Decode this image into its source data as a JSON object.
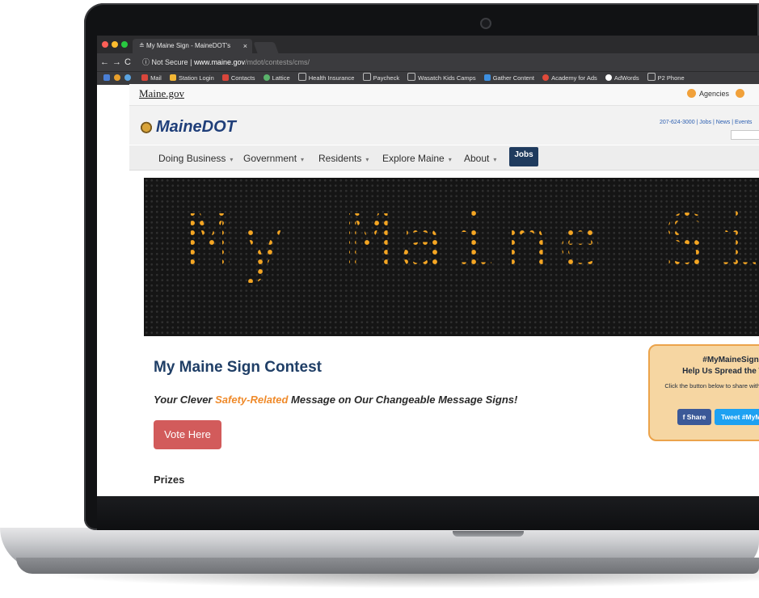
{
  "browser": {
    "tab_title": "My Maine Sign - MaineDOT's",
    "url_security": "Not Secure",
    "url_host": "www.maine.gov",
    "url_path": "/mdot/contests/cms/",
    "bookmarks": [
      "Mail",
      "Station Login",
      "Contacts",
      "Lattice",
      "Health Insurance",
      "Paycheck",
      "Wasatch Kids Camps",
      "Gather Content",
      "Academy for Ads",
      "AdWords",
      "P2 Phone"
    ]
  },
  "gov_bar": {
    "logo": "Maine.gov",
    "agencies": "Agencies"
  },
  "header": {
    "logo": "MaineDOT",
    "contact": "207-624-3000 | Jobs | News | Events"
  },
  "nav": {
    "items": [
      "Doing Business",
      "Government",
      "Residents",
      "Explore Maine",
      "About"
    ],
    "jobs": "Jobs"
  },
  "sign": {
    "text": "My Maine Sign"
  },
  "main": {
    "title": "My Maine Sign Contest",
    "tagline_pre": "Your Clever ",
    "tagline_highlight": "Safety-Related",
    "tagline_post": " Message on Our Changeable Message Signs!",
    "vote_button": "Vote Here",
    "prizes_heading": "Prizes"
  },
  "share_box": {
    "hashtag": "#MyMaineSign",
    "heading": "Help Us Spread the Word",
    "text": "Click the button below to share with your friends!",
    "facebook": "f Share",
    "twitter": "Tweet #MyMaineSign"
  },
  "colors": {
    "navy": "#1f3e66",
    "accent_orange": "#ef8a2a",
    "vote_red": "#d25b5b",
    "sign_led": "#f5a623"
  }
}
